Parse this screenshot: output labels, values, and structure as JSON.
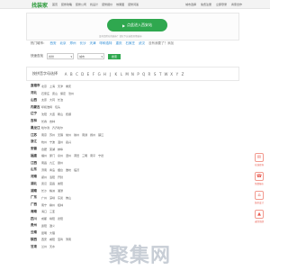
{
  "header": {
    "logo": "找装家",
    "nav": [
      "首页",
      "装修攻略",
      "装修公司",
      "找设计",
      "装修报价",
      "效果图",
      "装修问答"
    ],
    "utils": [
      "城市选择",
      "免费注册",
      "立即登录",
      "商家合作"
    ]
  },
  "entry": {
    "button_label": "点此进入西安站",
    "note": "没有您所在的城市？请在下方选择其他城市"
  },
  "hot_cities": {
    "label": "热门城市：",
    "cities": [
      "西安",
      "北京",
      "郑州",
      "长沙",
      "天津",
      "呼和浩特",
      "重庆",
      "石家庄",
      "武汉"
    ],
    "more": "没有我要了？添加"
  },
  "quick_search": {
    "label": "快速查找",
    "province_placeholder": "省份",
    "city_placeholder": "城市",
    "button": "搜索"
  },
  "letters": {
    "title": "按拼音字母选择",
    "items": [
      "A",
      "B",
      "C",
      "D",
      "E",
      "F",
      "G",
      "H",
      "J",
      "K",
      "L",
      "M",
      "N",
      "P",
      "Q",
      "R",
      "S",
      "T",
      "W",
      "X",
      "Y",
      "Z"
    ]
  },
  "provinces": [
    {
      "name": "直辖市",
      "cities": [
        "北京",
        "上海",
        "天津",
        "重庆"
      ]
    },
    {
      "name": "河北",
      "cities": [
        "石家庄",
        "唐山",
        "保定",
        "沧州"
      ]
    },
    {
      "name": "山西",
      "cities": [
        "太原",
        "大同",
        "长治"
      ]
    },
    {
      "name": "内蒙古",
      "cities": [
        "呼和浩特",
        "包头"
      ]
    },
    {
      "name": "辽宁",
      "cities": [
        "沈阳",
        "大连",
        "鞍山",
        "抚顺"
      ]
    },
    {
      "name": "吉林",
      "cities": [
        "长春",
        "吉林"
      ]
    },
    {
      "name": "黑龙江",
      "cities": [
        "哈尔滨",
        "齐齐哈尔"
      ]
    },
    {
      "name": "江苏",
      "cities": [
        "南京",
        "苏州",
        "无锡",
        "常州",
        "徐州",
        "南通",
        "扬州",
        "镇江"
      ]
    },
    {
      "name": "浙江",
      "cities": [
        "杭州",
        "宁波",
        "温州",
        "嘉兴"
      ]
    },
    {
      "name": "安徽",
      "cities": [
        "合肥",
        "芜湖",
        "蚌埠"
      ]
    },
    {
      "name": "福建",
      "cities": [
        "福州",
        "厦门",
        "泉州",
        "漳州",
        "莆田",
        "三明",
        "南平",
        "宁德"
      ]
    },
    {
      "name": "江西",
      "cities": [
        "南昌",
        "九江",
        "赣州"
      ]
    },
    {
      "name": "山东",
      "cities": [
        "济南",
        "青岛",
        "烟台",
        "潍坊",
        "临沂"
      ]
    },
    {
      "name": "河南",
      "cities": [
        "郑州",
        "洛阳",
        "开封"
      ]
    },
    {
      "name": "湖北",
      "cities": [
        "武汉",
        "宜昌",
        "襄阳"
      ]
    },
    {
      "name": "湖南",
      "cities": [
        "长沙",
        "株洲",
        "湘潭"
      ]
    },
    {
      "name": "广东",
      "cities": [
        "广州",
        "深圳",
        "东莞",
        "佛山"
      ]
    },
    {
      "name": "广西",
      "cities": [
        "南宁",
        "柳州",
        "桂林"
      ]
    },
    {
      "name": "海南",
      "cities": [
        "海口",
        "三亚"
      ]
    },
    {
      "name": "四川",
      "cities": [
        "成都",
        "绵阳",
        "德阳"
      ]
    },
    {
      "name": "贵州",
      "cities": [
        "贵阳",
        "遵义"
      ]
    },
    {
      "name": "云南",
      "cities": [
        "昆明",
        "大理"
      ]
    },
    {
      "name": "陕西",
      "cities": [
        "西安",
        "咸阳",
        "宝鸡",
        "渭南"
      ]
    },
    {
      "name": "甘肃",
      "cities": [
        "兰州",
        "天水"
      ]
    }
  ],
  "side_rail": [
    {
      "icon": "✉",
      "label": "在线咨询"
    },
    {
      "icon": "☎",
      "label": "免费报价"
    },
    {
      "icon": "⌂",
      "label": "装修设计"
    },
    {
      "icon": "▲",
      "label": "返回顶部"
    }
  ],
  "watermark": "聚集网"
}
